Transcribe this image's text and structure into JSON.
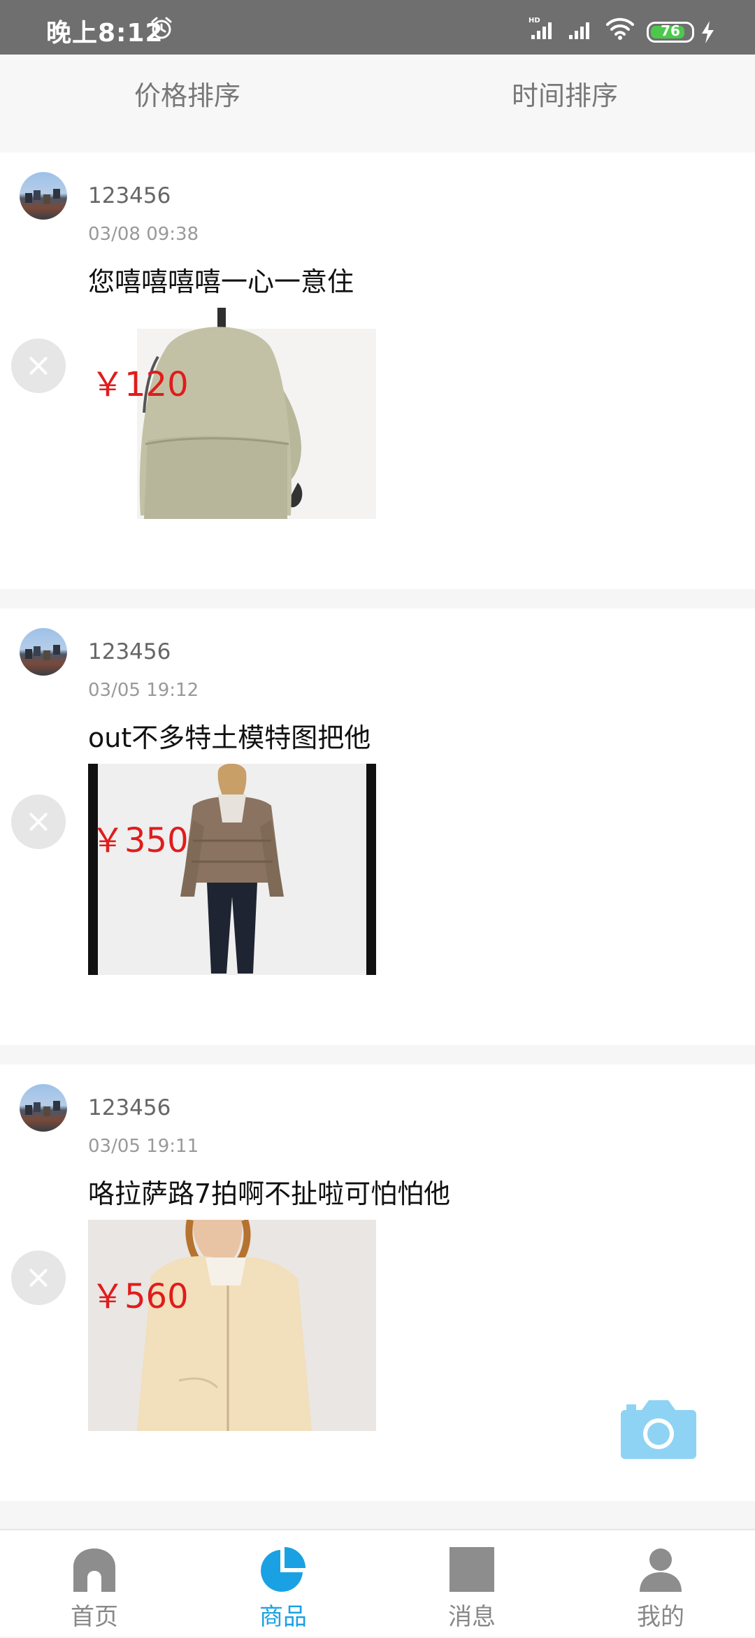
{
  "status_bar": {
    "time": "晚上8:12",
    "battery": "76"
  },
  "sort": {
    "price_label": "价格排序",
    "time_label": "时间排序"
  },
  "posts": [
    {
      "user": "123456",
      "date": "03/08 09:38",
      "description": "您嘻嘻嘻嘻一心一意住",
      "price": "￥120",
      "image": "backpack"
    },
    {
      "user": "123456",
      "date": "03/05 19:12",
      "description": "out不多特土模特图把他",
      "price": "￥350",
      "image": "puffer-jacket"
    },
    {
      "user": "123456",
      "date": "03/05 19:11",
      "description": "咯拉萨路7拍啊不扯啦可怕怕他",
      "price": "￥560",
      "image": "hooded-jacket"
    }
  ],
  "tabs": [
    {
      "label": "首页",
      "icon": "home-icon"
    },
    {
      "label": "商品",
      "icon": "pie-chart-icon"
    },
    {
      "label": "消息",
      "icon": "message-icon"
    },
    {
      "label": "我的",
      "icon": "profile-icon"
    }
  ],
  "colors": {
    "accent": "#1aa1e4",
    "price": "#e01c1c",
    "camera": "#8fd3f4"
  }
}
